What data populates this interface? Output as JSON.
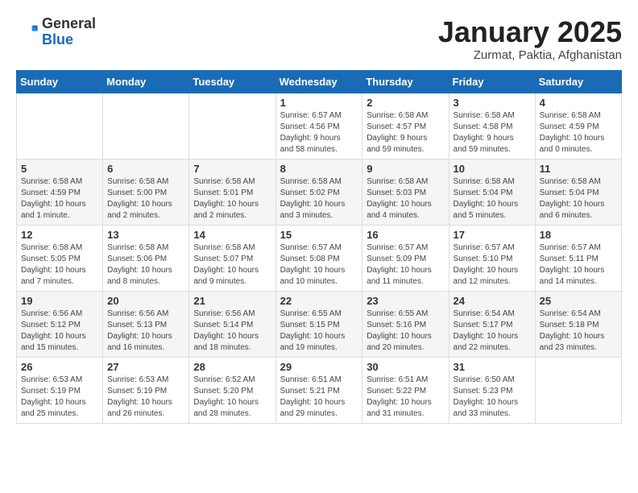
{
  "header": {
    "logo_general": "General",
    "logo_blue": "Blue",
    "month_title": "January 2025",
    "location": "Zurmat, Paktia, Afghanistan"
  },
  "weekdays": [
    "Sunday",
    "Monday",
    "Tuesday",
    "Wednesday",
    "Thursday",
    "Friday",
    "Saturday"
  ],
  "weeks": [
    [
      {
        "day": "",
        "info": ""
      },
      {
        "day": "",
        "info": ""
      },
      {
        "day": "",
        "info": ""
      },
      {
        "day": "1",
        "info": "Sunrise: 6:57 AM\nSunset: 4:56 PM\nDaylight: 9 hours\nand 58 minutes."
      },
      {
        "day": "2",
        "info": "Sunrise: 6:58 AM\nSunset: 4:57 PM\nDaylight: 9 hours\nand 59 minutes."
      },
      {
        "day": "3",
        "info": "Sunrise: 6:58 AM\nSunset: 4:58 PM\nDaylight: 9 hours\nand 59 minutes."
      },
      {
        "day": "4",
        "info": "Sunrise: 6:58 AM\nSunset: 4:59 PM\nDaylight: 10 hours\nand 0 minutes."
      }
    ],
    [
      {
        "day": "5",
        "info": "Sunrise: 6:58 AM\nSunset: 4:59 PM\nDaylight: 10 hours\nand 1 minute."
      },
      {
        "day": "6",
        "info": "Sunrise: 6:58 AM\nSunset: 5:00 PM\nDaylight: 10 hours\nand 2 minutes."
      },
      {
        "day": "7",
        "info": "Sunrise: 6:58 AM\nSunset: 5:01 PM\nDaylight: 10 hours\nand 2 minutes."
      },
      {
        "day": "8",
        "info": "Sunrise: 6:58 AM\nSunset: 5:02 PM\nDaylight: 10 hours\nand 3 minutes."
      },
      {
        "day": "9",
        "info": "Sunrise: 6:58 AM\nSunset: 5:03 PM\nDaylight: 10 hours\nand 4 minutes."
      },
      {
        "day": "10",
        "info": "Sunrise: 6:58 AM\nSunset: 5:04 PM\nDaylight: 10 hours\nand 5 minutes."
      },
      {
        "day": "11",
        "info": "Sunrise: 6:58 AM\nSunset: 5:04 PM\nDaylight: 10 hours\nand 6 minutes."
      }
    ],
    [
      {
        "day": "12",
        "info": "Sunrise: 6:58 AM\nSunset: 5:05 PM\nDaylight: 10 hours\nand 7 minutes."
      },
      {
        "day": "13",
        "info": "Sunrise: 6:58 AM\nSunset: 5:06 PM\nDaylight: 10 hours\nand 8 minutes."
      },
      {
        "day": "14",
        "info": "Sunrise: 6:58 AM\nSunset: 5:07 PM\nDaylight: 10 hours\nand 9 minutes."
      },
      {
        "day": "15",
        "info": "Sunrise: 6:57 AM\nSunset: 5:08 PM\nDaylight: 10 hours\nand 10 minutes."
      },
      {
        "day": "16",
        "info": "Sunrise: 6:57 AM\nSunset: 5:09 PM\nDaylight: 10 hours\nand 11 minutes."
      },
      {
        "day": "17",
        "info": "Sunrise: 6:57 AM\nSunset: 5:10 PM\nDaylight: 10 hours\nand 12 minutes."
      },
      {
        "day": "18",
        "info": "Sunrise: 6:57 AM\nSunset: 5:11 PM\nDaylight: 10 hours\nand 14 minutes."
      }
    ],
    [
      {
        "day": "19",
        "info": "Sunrise: 6:56 AM\nSunset: 5:12 PM\nDaylight: 10 hours\nand 15 minutes."
      },
      {
        "day": "20",
        "info": "Sunrise: 6:56 AM\nSunset: 5:13 PM\nDaylight: 10 hours\nand 16 minutes."
      },
      {
        "day": "21",
        "info": "Sunrise: 6:56 AM\nSunset: 5:14 PM\nDaylight: 10 hours\nand 18 minutes."
      },
      {
        "day": "22",
        "info": "Sunrise: 6:55 AM\nSunset: 5:15 PM\nDaylight: 10 hours\nand 19 minutes."
      },
      {
        "day": "23",
        "info": "Sunrise: 6:55 AM\nSunset: 5:16 PM\nDaylight: 10 hours\nand 20 minutes."
      },
      {
        "day": "24",
        "info": "Sunrise: 6:54 AM\nSunset: 5:17 PM\nDaylight: 10 hours\nand 22 minutes."
      },
      {
        "day": "25",
        "info": "Sunrise: 6:54 AM\nSunset: 5:18 PM\nDaylight: 10 hours\nand 23 minutes."
      }
    ],
    [
      {
        "day": "26",
        "info": "Sunrise: 6:53 AM\nSunset: 5:19 PM\nDaylight: 10 hours\nand 25 minutes."
      },
      {
        "day": "27",
        "info": "Sunrise: 6:53 AM\nSunset: 5:19 PM\nDaylight: 10 hours\nand 26 minutes."
      },
      {
        "day": "28",
        "info": "Sunrise: 6:52 AM\nSunset: 5:20 PM\nDaylight: 10 hours\nand 28 minutes."
      },
      {
        "day": "29",
        "info": "Sunrise: 6:51 AM\nSunset: 5:21 PM\nDaylight: 10 hours\nand 29 minutes."
      },
      {
        "day": "30",
        "info": "Sunrise: 6:51 AM\nSunset: 5:22 PM\nDaylight: 10 hours\nand 31 minutes."
      },
      {
        "day": "31",
        "info": "Sunrise: 6:50 AM\nSunset: 5:23 PM\nDaylight: 10 hours\nand 33 minutes."
      },
      {
        "day": "",
        "info": ""
      }
    ]
  ]
}
